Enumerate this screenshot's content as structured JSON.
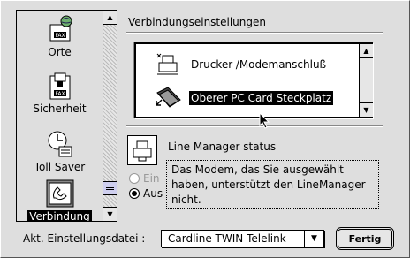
{
  "sidebar": {
    "items": [
      {
        "label": "Orte",
        "icon": "globe-fax-icon",
        "selected": false
      },
      {
        "label": "Sicherheit",
        "icon": "fax-lock-icon",
        "selected": false
      },
      {
        "label": "Toll Saver",
        "icon": "clock-phone-icon",
        "selected": false
      },
      {
        "label": "Verbindung",
        "icon": "phone-connection-icon",
        "selected": true
      }
    ]
  },
  "main": {
    "section_title": "Verbindungseinstellungen",
    "ports": [
      {
        "label": "Drucker-/Modemanschluß",
        "icon": "printer-port-icon",
        "selected": false
      },
      {
        "label": "Oberer PC Card Steckplatz",
        "icon": "pc-card-icon",
        "selected": true
      }
    ],
    "status_title": "Line Manager status",
    "radio_on": "Ein",
    "radio_off": "Aus",
    "info_text": "Das Modem, das Sie ausgewählt haben, unterstützt den LineManager nicht."
  },
  "footer": {
    "settings_label": "Akt. Einstellungsdatei :",
    "settings_value": "Cardline TWIN Telelink",
    "ok_label": "Fertig"
  },
  "colors": {
    "selection": "#000000",
    "background": "#dedede",
    "thumb": "#cfcfef"
  }
}
